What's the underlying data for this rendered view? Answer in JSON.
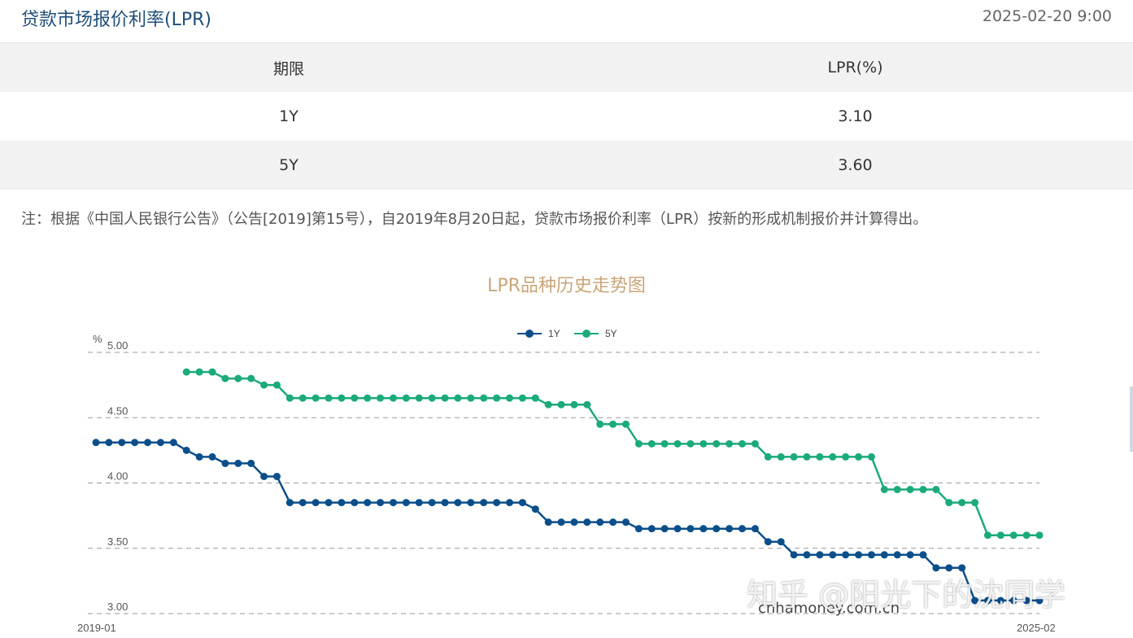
{
  "header": {
    "title": "贷款市场报价利率(LPR)",
    "datetime": "2025-02-20 9:00"
  },
  "table": {
    "headers": [
      "期限",
      "LPR(%)"
    ],
    "rows": [
      [
        "1Y",
        "3.10"
      ],
      [
        "5Y",
        "3.60"
      ]
    ]
  },
  "note": "注：根据《中国人民银行公告》（公告[2019]第15号），自2019年8月20日起，贷款市场报价利率（LPR）按新的形成机制报价并计算得出。",
  "watermark": "知乎 @阳光下的沈同学",
  "source": "cnhamoney.com.cn",
  "chart_data": {
    "type": "line",
    "title": "LPR品种历史走势图",
    "ylabel": "%",
    "ylim": [
      3.0,
      5.0
    ],
    "yticks": [
      "5.00",
      "4.50",
      "4.00",
      "3.50",
      "3.00"
    ],
    "x_start_label": "2019-01",
    "x_end_label": "2025-02",
    "grid": true,
    "legend_position": "top-center",
    "colors": {
      "1Y": "#0b4f8a",
      "5Y": "#1aab78"
    },
    "series": [
      {
        "name": "1Y",
        "values": [
          4.31,
          4.31,
          4.31,
          4.31,
          4.31,
          4.31,
          4.31,
          4.25,
          4.2,
          4.2,
          4.15,
          4.15,
          4.15,
          4.05,
          4.05,
          3.85,
          3.85,
          3.85,
          3.85,
          3.85,
          3.85,
          3.85,
          3.85,
          3.85,
          3.85,
          3.85,
          3.85,
          3.85,
          3.85,
          3.85,
          3.85,
          3.85,
          3.85,
          3.85,
          3.8,
          3.7,
          3.7,
          3.7,
          3.7,
          3.7,
          3.7,
          3.7,
          3.65,
          3.65,
          3.65,
          3.65,
          3.65,
          3.65,
          3.65,
          3.65,
          3.65,
          3.65,
          3.55,
          3.55,
          3.45,
          3.45,
          3.45,
          3.45,
          3.45,
          3.45,
          3.45,
          3.45,
          3.45,
          3.45,
          3.45,
          3.35,
          3.35,
          3.35,
          3.1,
          3.1,
          3.1,
          3.1,
          3.1,
          3.1
        ]
      },
      {
        "name": "5Y",
        "values": [
          null,
          null,
          null,
          null,
          null,
          null,
          null,
          4.85,
          4.85,
          4.85,
          4.8,
          4.8,
          4.8,
          4.75,
          4.75,
          4.65,
          4.65,
          4.65,
          4.65,
          4.65,
          4.65,
          4.65,
          4.65,
          4.65,
          4.65,
          4.65,
          4.65,
          4.65,
          4.65,
          4.65,
          4.65,
          4.65,
          4.65,
          4.65,
          4.65,
          4.6,
          4.6,
          4.6,
          4.6,
          4.45,
          4.45,
          4.45,
          4.3,
          4.3,
          4.3,
          4.3,
          4.3,
          4.3,
          4.3,
          4.3,
          4.3,
          4.3,
          4.2,
          4.2,
          4.2,
          4.2,
          4.2,
          4.2,
          4.2,
          4.2,
          4.2,
          3.95,
          3.95,
          3.95,
          3.95,
          3.95,
          3.85,
          3.85,
          3.85,
          3.6,
          3.6,
          3.6,
          3.6,
          3.6
        ]
      }
    ]
  }
}
